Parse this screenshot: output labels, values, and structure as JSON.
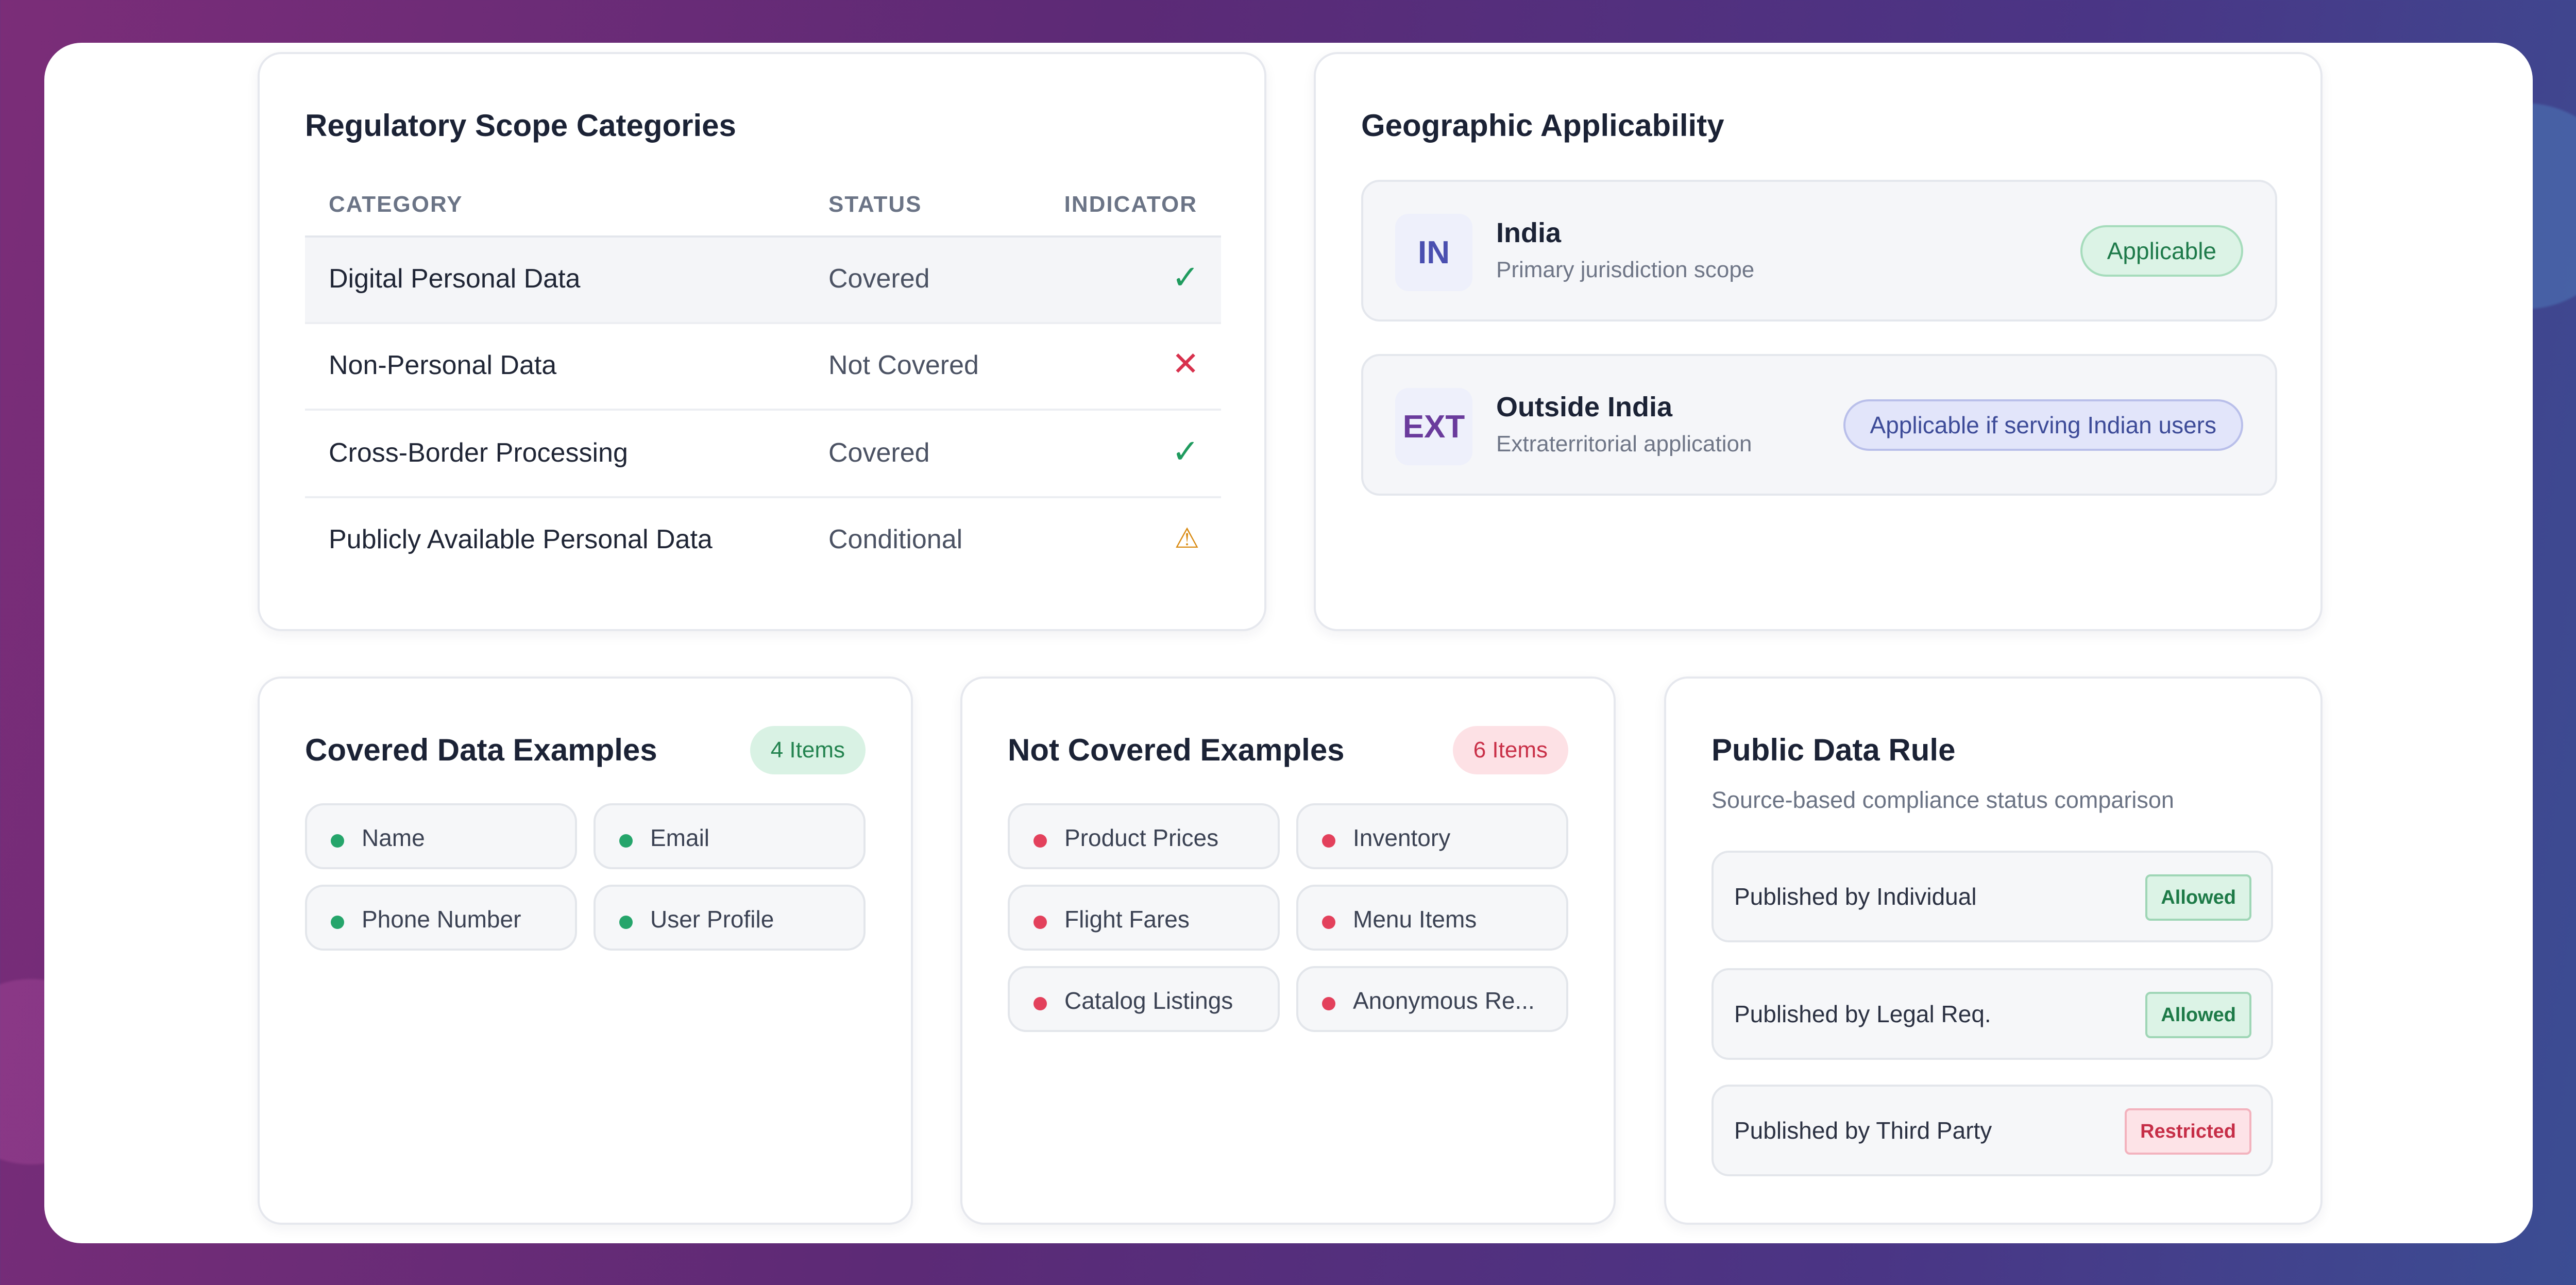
{
  "scope": {
    "title": "Regulatory Scope Categories",
    "columns": [
      "CATEGORY",
      "STATUS",
      "INDICATOR"
    ],
    "rows": [
      {
        "category": "Digital Personal Data",
        "status": "Covered",
        "indicator": "✓",
        "indicator_color": "#1f9b5e"
      },
      {
        "category": "Non-Personal Data",
        "status": "Not Covered",
        "indicator": "✕",
        "indicator_color": "#d8314d"
      },
      {
        "category": "Cross-Border Processing",
        "status": "Covered",
        "indicator": "✓",
        "indicator_color": "#1f9b5e"
      },
      {
        "category": "Publicly Available Personal Data",
        "status": "Conditional",
        "indicator": "⚠",
        "indicator_color": "#d98a12"
      }
    ]
  },
  "geo": {
    "title": "Geographic Applicability",
    "items": [
      {
        "code": "IN",
        "name": "India",
        "desc": "Primary jurisdiction scope",
        "pill": "Applicable",
        "code_color": "#4a4fb0"
      },
      {
        "code": "EXT",
        "name": "Outside India",
        "desc": "Extraterritorial application",
        "pill": "Applicable if serving Indian users",
        "code_color": "#6a3b9c"
      }
    ]
  },
  "covered": {
    "title": "Covered Data Examples",
    "badge": "4 Items",
    "items": [
      "Name",
      "Email",
      "Phone Number",
      "User Profile"
    ]
  },
  "not_covered": {
    "title": "Not Covered Examples",
    "badge": "6 Items",
    "items": [
      "Product Prices",
      "Inventory",
      "Flight Fares",
      "Menu Items",
      "Catalog Listings",
      "Anonymous Re..."
    ]
  },
  "public_rule": {
    "title": "Public Data Rule",
    "subtitle": "Source-based compliance status comparison",
    "rows": [
      {
        "label": "Published by Individual",
        "status": "Allowed"
      },
      {
        "label": "Published by Legal Req.",
        "status": "Allowed"
      },
      {
        "label": "Published by Third Party",
        "status": "Restricted"
      }
    ]
  }
}
